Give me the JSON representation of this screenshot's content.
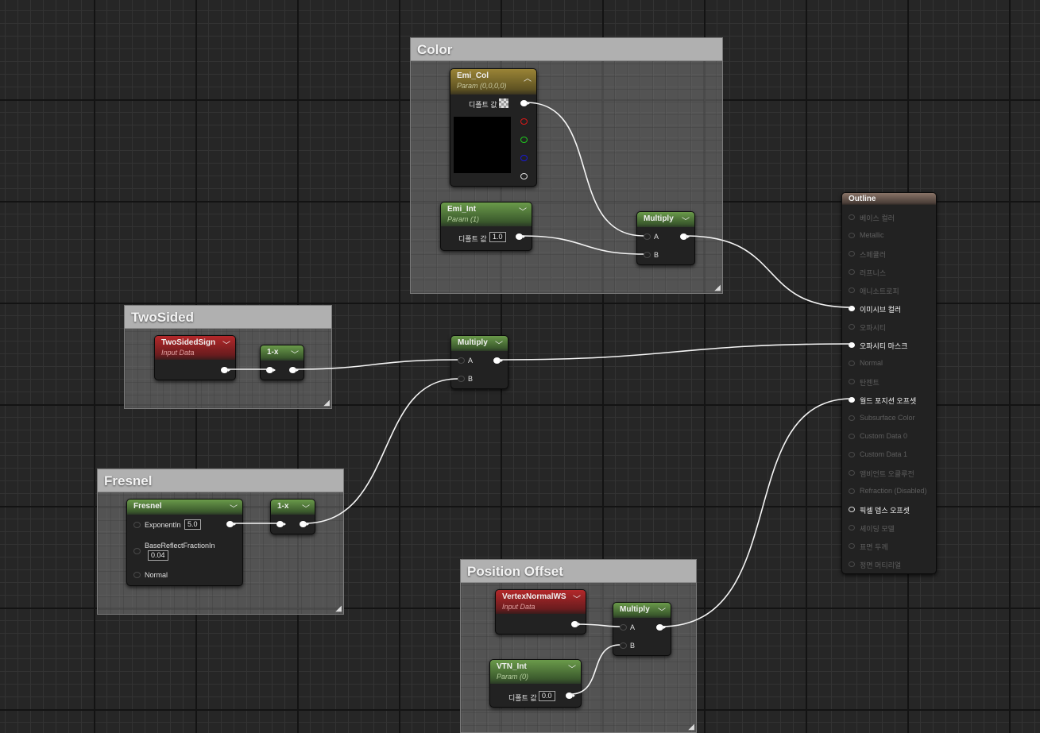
{
  "comments": {
    "color": "Color",
    "twosided": "TwoSided",
    "fresnel": "Fresnel",
    "position_offset": "Position Offset"
  },
  "emi_col": {
    "title": "Emi_Col",
    "subtitle": "Param (0,0,0,0)",
    "default_label": "디폴트 값"
  },
  "emi_int": {
    "title": "Emi_Int",
    "subtitle": "Param (1)",
    "default_label": "디폴트 값",
    "value": "1.0"
  },
  "multiply_color": {
    "title": "Multiply",
    "a": "A",
    "b": "B"
  },
  "twosidedsign": {
    "title": "TwoSidedSign",
    "subtitle": "Input Data"
  },
  "one_minus_1": {
    "title": "1-x"
  },
  "multiply_mid": {
    "title": "Multiply",
    "a": "A",
    "b": "B"
  },
  "fresnel_node": {
    "title": "Fresnel",
    "exponent_label": "ExponentIn",
    "exponent_value": "5.0",
    "base_label": "BaseReflectFractionIn",
    "base_value": "0.04",
    "normal_label": "Normal"
  },
  "one_minus_2": {
    "title": "1-x"
  },
  "vertexnormal": {
    "title": "VertexNormalWS",
    "subtitle": "Input Data"
  },
  "vtn_int": {
    "title": "VTN_Int",
    "subtitle": "Param (0)",
    "default_label": "디폴트 값",
    "value": "0.0"
  },
  "multiply_pos": {
    "title": "Multiply",
    "a": "A",
    "b": "B"
  },
  "outline": {
    "title": "Outline",
    "pins": [
      {
        "label": "베이스 컬러",
        "active": false
      },
      {
        "label": "Metallic",
        "active": false
      },
      {
        "label": "스페큘러",
        "active": false
      },
      {
        "label": "러프니스",
        "active": false
      },
      {
        "label": "애니소트로피",
        "active": false
      },
      {
        "label": "이미시브 컬러",
        "active": true
      },
      {
        "label": "오파시티",
        "active": false
      },
      {
        "label": "오파시티 마스크",
        "active": true
      },
      {
        "label": "Normal",
        "active": false
      },
      {
        "label": "탄젠트",
        "active": false
      },
      {
        "label": "월드 포지션 오프셋",
        "active": true
      },
      {
        "label": "Subsurface Color",
        "active": false
      },
      {
        "label": "Custom Data 0",
        "active": false
      },
      {
        "label": "Custom Data 1",
        "active": false
      },
      {
        "label": "앰비언트 오클루전",
        "active": false
      },
      {
        "label": "Refraction (Disabled)",
        "active": false
      },
      {
        "label": "픽셀 뎁스 오프셋",
        "active": true
      },
      {
        "label": "셰이딩 모델",
        "active": false
      },
      {
        "label": "표면 두께",
        "active": false
      },
      {
        "label": "정면 머티리얼",
        "active": false
      }
    ]
  }
}
